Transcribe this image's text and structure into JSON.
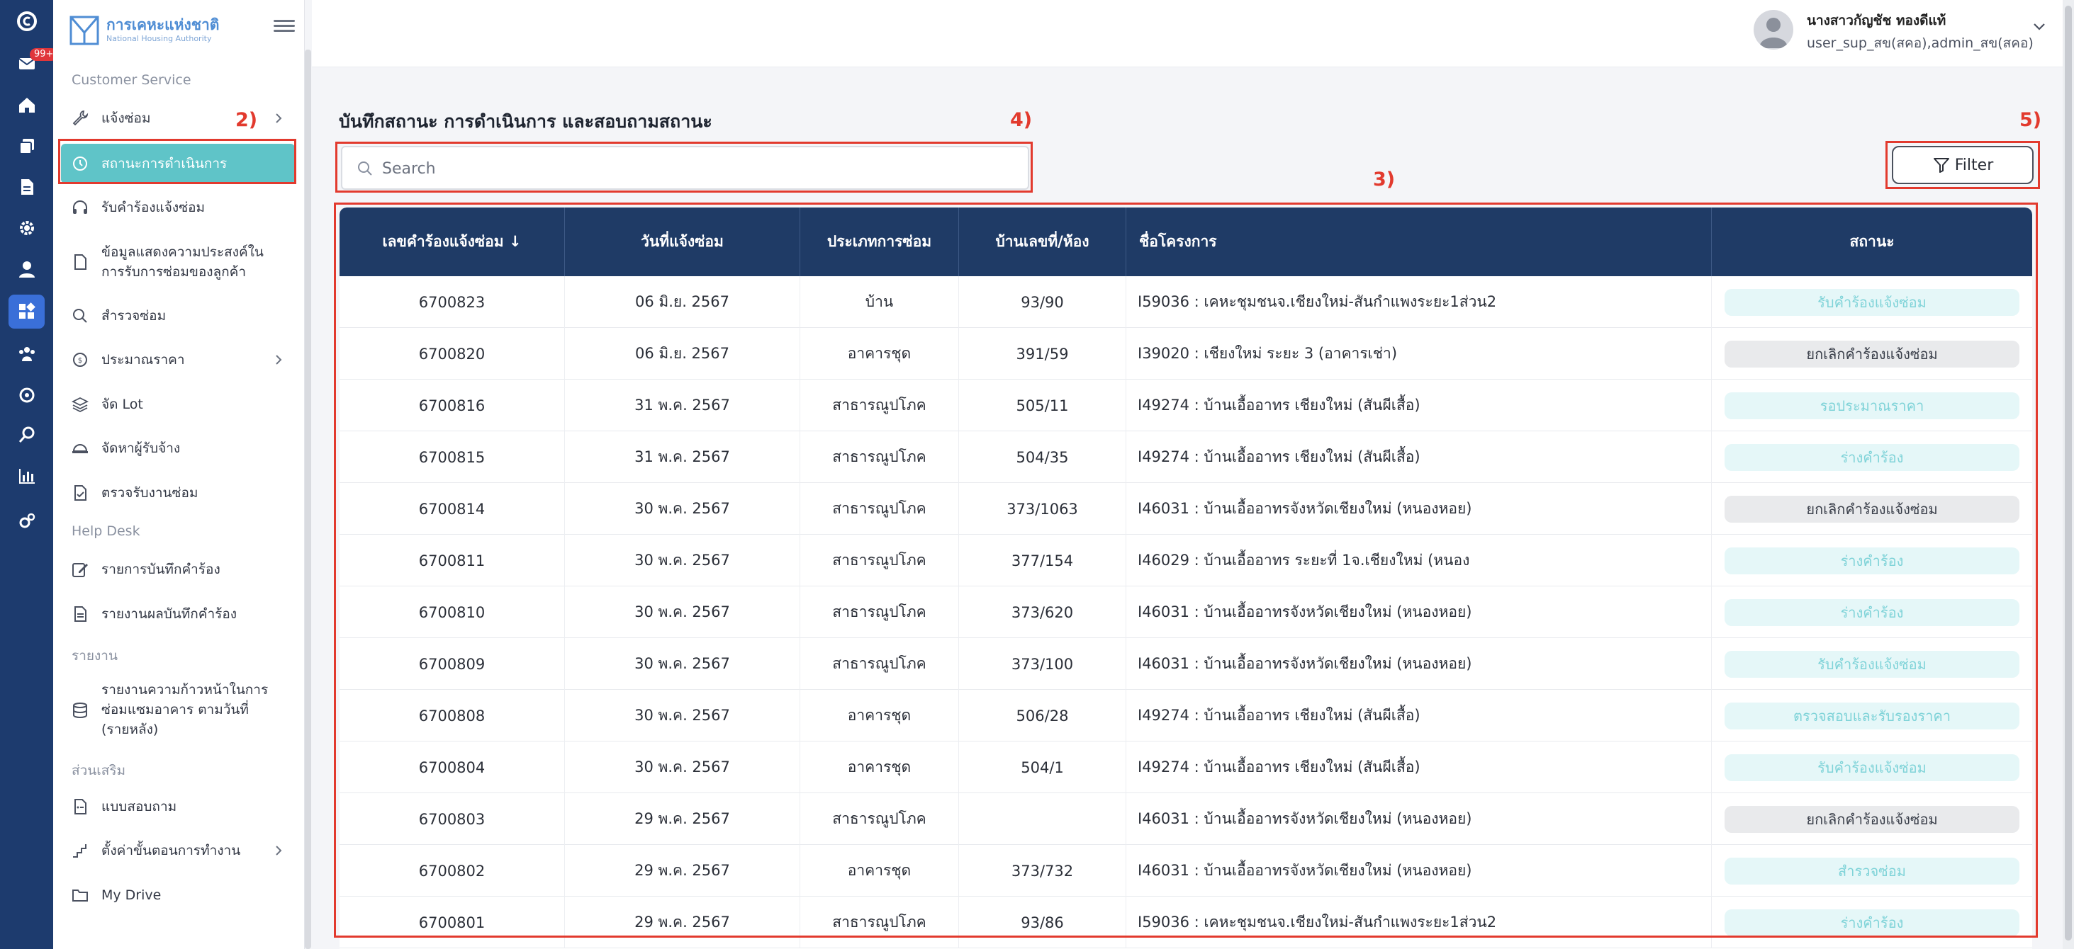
{
  "brand": {
    "name_th": "การเคหะแห่งชาติ",
    "name_en": "National Housing Authority",
    "brand_color": "#4f8dd4"
  },
  "rail": {
    "badge": "99+",
    "icons": [
      "logo-icon",
      "inbox-icon",
      "home-icon",
      "stack-icon",
      "document-icon",
      "settings-gear-icon",
      "user-icon",
      "dashboard-icon",
      "team-icon",
      "cog-icon",
      "search-icon",
      "bar-chart-icon",
      "gears-icon"
    ],
    "active_icon": "dashboard-icon"
  },
  "sidebar": {
    "sections": {
      "customer_service": "Customer Service",
      "help_desk": "Help Desk",
      "reports": "รายงาน",
      "extras": "ส่วนเสริม"
    },
    "items": [
      {
        "label": "แจ้งซ่อม",
        "icon": "wrench-icon",
        "has_arrow": true
      },
      {
        "label": "สถานะการดำเนินการ",
        "icon": "history-icon",
        "active": true
      },
      {
        "label": "รับคำร้องแจ้งซ่อม",
        "icon": "headset-icon"
      },
      {
        "label": "ข้อมูลแสดงความประสงค์ในการรับการซ่อมของลูกค้า",
        "icon": "file-icon"
      },
      {
        "label": "สำรวจซ่อม",
        "icon": "search-icon"
      },
      {
        "label": "ประมาณราคา",
        "icon": "coin-icon",
        "has_arrow": true
      },
      {
        "label": "จัด Lot",
        "icon": "layers-icon"
      },
      {
        "label": "จัดหาผู้รับจ้าง",
        "icon": "helmet-icon"
      },
      {
        "label": "ตรวจรับงานซ่อม",
        "icon": "file-check-icon"
      },
      {
        "label": "รายการบันทึกคำร้อง",
        "icon": "edit-icon"
      },
      {
        "label": "รายงานผลบันทึกคำร้อง",
        "icon": "file-text-icon"
      },
      {
        "label": "รายงานความก้าวหน้าในการซ่อมแซมอาคาร ตามวันที่ (รายหลัง)",
        "icon": "database-icon"
      },
      {
        "label": "แบบสอบถาม",
        "icon": "survey-icon"
      },
      {
        "label": "ตั้งค่าขั้นตอนการทำงาน",
        "icon": "steps-icon",
        "has_arrow": true
      },
      {
        "label": "My Drive",
        "icon": "folder-icon"
      }
    ]
  },
  "user": {
    "name": "นางสาวกัญชัช ทองดีแท้",
    "roles": "user_sup_สข(สคอ),admin_สข(สคอ)"
  },
  "main": {
    "title": "บันทึกสถานะ การดำเนินการ และสอบถามสถานะ",
    "search_placeholder": "Search",
    "filter_label": "Filter"
  },
  "table": {
    "columns": [
      "เลขคำร้องแจ้งซ่อม ↓",
      "วันที่แจ้งซ่อม",
      "ประเภทการซ่อม",
      "บ้านเลขที่/ห้อง",
      "ชื่อโครงการ",
      "สถานะ"
    ],
    "rows": [
      {
        "id": "6700823",
        "date": "06 มิ.ย. 2567",
        "type": "บ้าน",
        "house": "93/90",
        "project": "I59036 : เคหะชุมชนจ.เชียงใหม่-สันกำแพงระยะ1ส่วน2",
        "status": "รับคำร้องแจ้งซ่อม",
        "status_style": "teal"
      },
      {
        "id": "6700820",
        "date": "06 มิ.ย. 2567",
        "type": "อาคารชุด",
        "house": "391/59",
        "project": "I39020 : เชียงใหม่ ระยะ 3 (อาคารเช่า)",
        "status": "ยกเลิกคำร้องแจ้งซ่อม",
        "status_style": "gray"
      },
      {
        "id": "6700816",
        "date": "31 พ.ค. 2567",
        "type": "สาธารณูปโภค",
        "house": "505/11",
        "project": "I49274 : บ้านเอื้ออาทร เชียงใหม่ (สันผีเสื้อ)",
        "status": "รอประมาณราคา",
        "status_style": "teal"
      },
      {
        "id": "6700815",
        "date": "31 พ.ค. 2567",
        "type": "สาธารณูปโภค",
        "house": "504/35",
        "project": "I49274 : บ้านเอื้ออาทร เชียงใหม่ (สันผีเสื้อ)",
        "status": "ร่างคำร้อง",
        "status_style": "teal"
      },
      {
        "id": "6700814",
        "date": "30 พ.ค. 2567",
        "type": "สาธารณูปโภค",
        "house": "373/1063",
        "project": "I46031 : บ้านเอื้ออาทรจังหวัดเชียงใหม่ (หนองหอย)",
        "status": "ยกเลิกคำร้องแจ้งซ่อม",
        "status_style": "gray"
      },
      {
        "id": "6700811",
        "date": "30 พ.ค. 2567",
        "type": "สาธารณูปโภค",
        "house": "377/154",
        "project": "I46029 : บ้านเอื้ออาทร ระยะที่ 1จ.เชียงใหม่ (หนอง",
        "status": "ร่างคำร้อง",
        "status_style": "teal"
      },
      {
        "id": "6700810",
        "date": "30 พ.ค. 2567",
        "type": "สาธารณูปโภค",
        "house": "373/620",
        "project": "I46031 : บ้านเอื้ออาทรจังหวัดเชียงใหม่ (หนองหอย)",
        "status": "ร่างคำร้อง",
        "status_style": "teal"
      },
      {
        "id": "6700809",
        "date": "30 พ.ค. 2567",
        "type": "สาธารณูปโภค",
        "house": "373/100",
        "project": "I46031 : บ้านเอื้ออาทรจังหวัดเชียงใหม่ (หนองหอย)",
        "status": "รับคำร้องแจ้งซ่อม",
        "status_style": "teal"
      },
      {
        "id": "6700808",
        "date": "30 พ.ค. 2567",
        "type": "อาคารชุด",
        "house": "506/28",
        "project": "I49274 : บ้านเอื้ออาทร เชียงใหม่ (สันผีเสื้อ)",
        "status": "ตรวจสอบและรับรองราคา",
        "status_style": "teal"
      },
      {
        "id": "6700804",
        "date": "30 พ.ค. 2567",
        "type": "อาคารชุด",
        "house": "504/1",
        "project": "I49274 : บ้านเอื้ออาทร เชียงใหม่ (สันผีเสื้อ)",
        "status": "รับคำร้องแจ้งซ่อม",
        "status_style": "teal"
      },
      {
        "id": "6700803",
        "date": "29 พ.ค. 2567",
        "type": "สาธารณูปโภค",
        "house": "",
        "project": "I46031 : บ้านเอื้ออาทรจังหวัดเชียงใหม่ (หนองหอย)",
        "status": "ยกเลิกคำร้องแจ้งซ่อม",
        "status_style": "gray"
      },
      {
        "id": "6700802",
        "date": "29 พ.ค. 2567",
        "type": "อาคารชุด",
        "house": "373/732",
        "project": "I46031 : บ้านเอื้ออาทรจังหวัดเชียงใหม่ (หนองหอย)",
        "status": "สำรวจซ่อม",
        "status_style": "teal"
      },
      {
        "id": "6700801",
        "date": "29 พ.ค. 2567",
        "type": "สาธารณูปโภค",
        "house": "93/86",
        "project": "I59036 : เคหะชุมชนจ.เชียงใหม่-สันกำแพงระยะ1ส่วน2",
        "status": "ร่างคำร้อง",
        "status_style": "teal"
      }
    ]
  },
  "annotations": [
    "2)",
    "3)",
    "4)",
    "5)"
  ],
  "colors": {
    "rail_bg": "#1d3b6e",
    "active_item": "#5fc4c8",
    "table_header": "#1f3b66",
    "annotation": "#e23a2e",
    "status_teal_text": "#7fd3d8",
    "status_gray_bg": "#e9eaec"
  }
}
